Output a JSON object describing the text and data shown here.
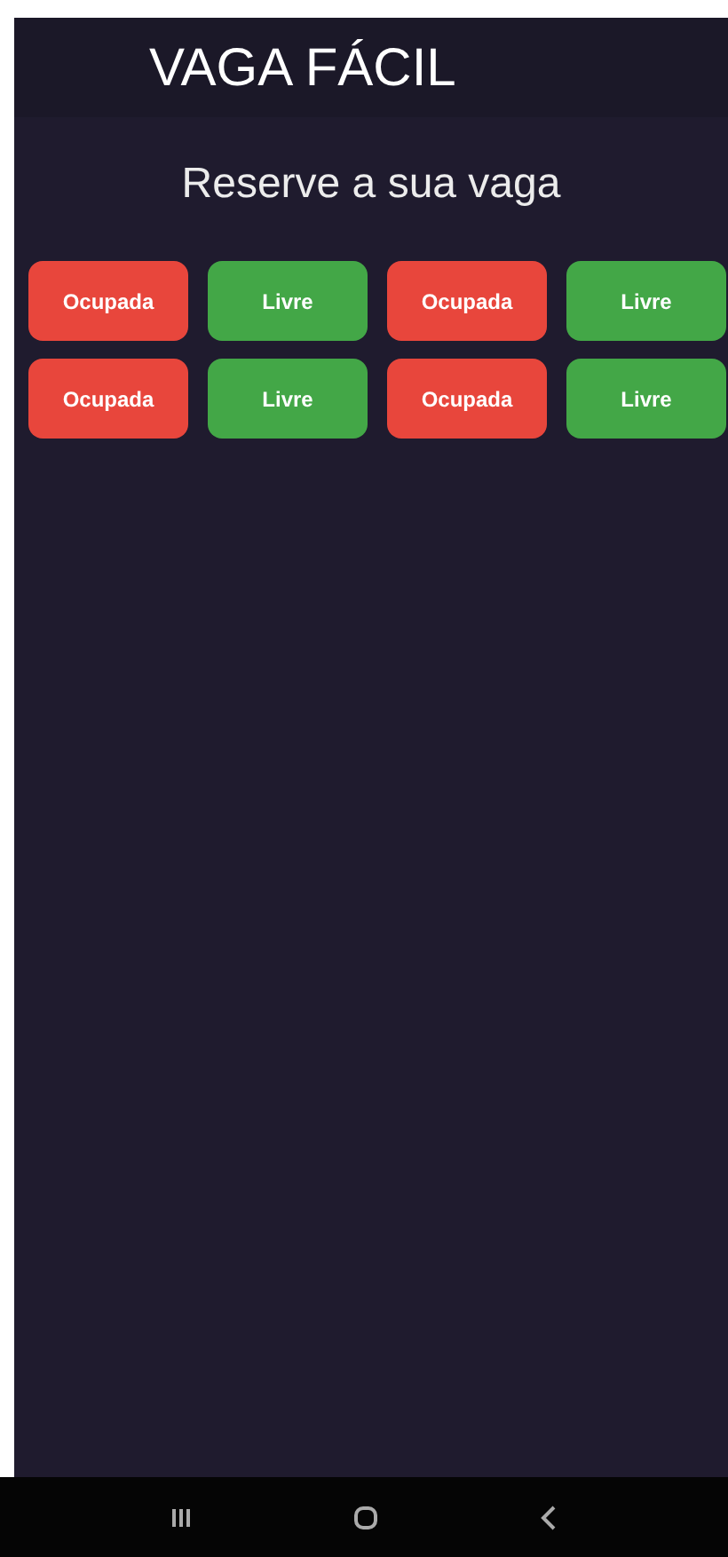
{
  "header": {
    "title": "VAGA FÁCIL"
  },
  "subtitle": "Reserve a sua vaga",
  "slots": [
    {
      "label": "Ocupada",
      "kind": "occupied"
    },
    {
      "label": "Livre",
      "kind": "free"
    },
    {
      "label": "Ocupada",
      "kind": "occupied"
    },
    {
      "label": "Livre",
      "kind": "free"
    },
    {
      "label": "Ocupada",
      "kind": "occupied"
    },
    {
      "label": "Livre",
      "kind": "free"
    },
    {
      "label": "Ocupada",
      "kind": "occupied"
    },
    {
      "label": "Livre",
      "kind": "free"
    }
  ]
}
